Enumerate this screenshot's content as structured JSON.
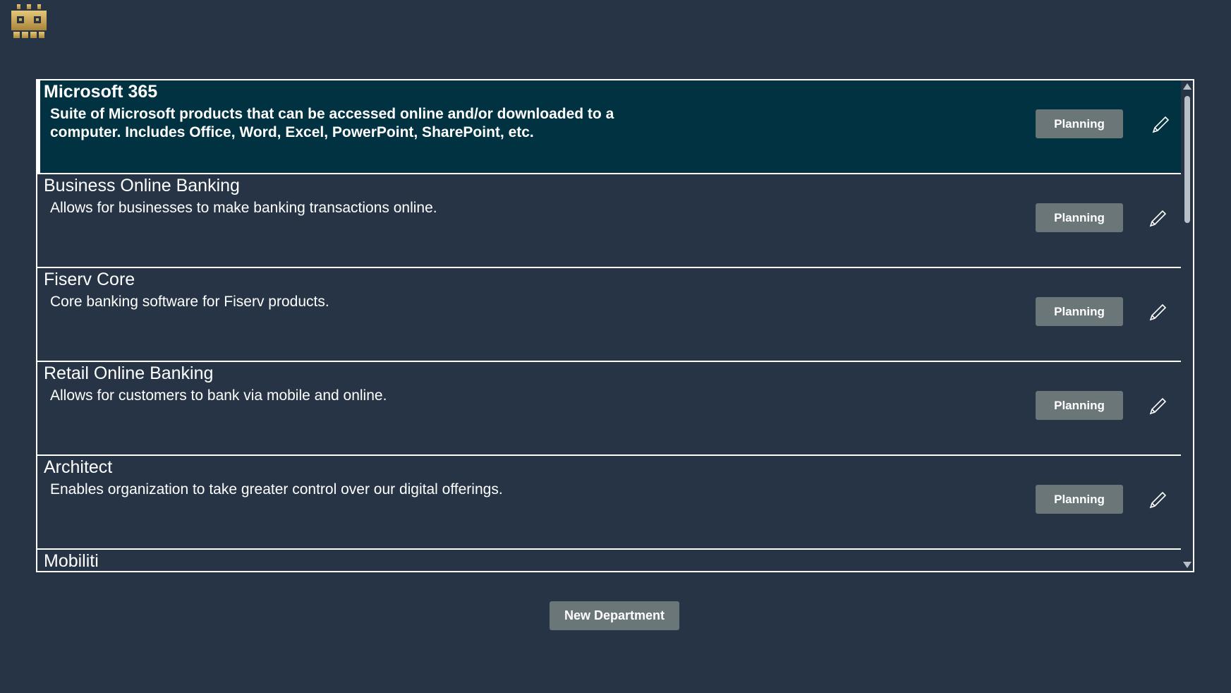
{
  "app": {
    "logo_icon": "robot-logo-icon",
    "accent_color": "#c9a54a"
  },
  "departments": [
    {
      "title": "Microsoft 365",
      "description": "Suite of Microsoft products that can be accessed online and/or downloaded to a computer.  Includes Office, Word, Excel, PowerPoint, SharePoint, etc.",
      "status": "Planning",
      "selected": true
    },
    {
      "title": "Business Online Banking",
      "description": "Allows for businesses to make banking transactions online.",
      "status": "Planning",
      "selected": false
    },
    {
      "title": "Fiserv Core",
      "description": "Core banking software for Fiserv products.",
      "status": "Planning",
      "selected": false
    },
    {
      "title": "Retail Online Banking",
      "description": "Allows for customers to bank via mobile and online.",
      "status": "Planning",
      "selected": false
    },
    {
      "title": "Architect",
      "description": "Enables organization to take greater control over our digital offerings.",
      "status": "Planning",
      "selected": false
    },
    {
      "title": "Mobiliti",
      "description": "",
      "status": "",
      "selected": false
    }
  ],
  "actions": {
    "new_department_label": "New Department"
  },
  "colors": {
    "background": "#263445",
    "selected_row": "#003241",
    "button": "#6b7679",
    "border": "#ffffff"
  }
}
